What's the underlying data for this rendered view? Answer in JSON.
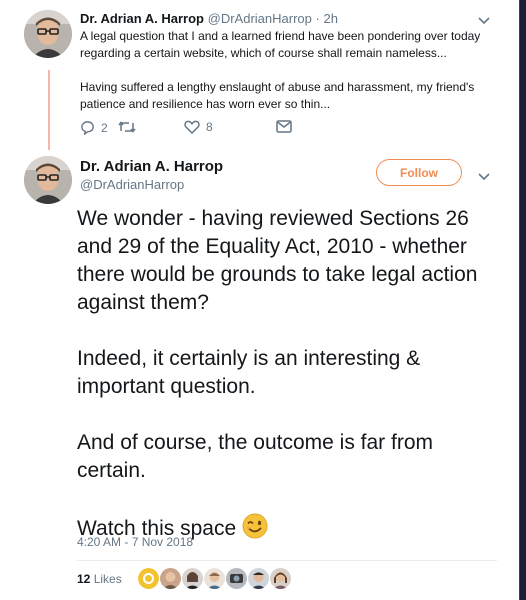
{
  "parent_tweet": {
    "author_name": "Dr. Adrian A. Harrop",
    "handle": "@DrAdrianHarrop",
    "separator": "·",
    "time": "2h",
    "paragraphs": [
      "A legal question that I and a learned friend have been pondering over today regarding a certain website, which of course shall remain nameless...",
      "Having suffered a lengthy enslaught of abuse and harassment, my friend's patience and resilience has worn ever so thin..."
    ],
    "reply_count": "2",
    "like_count": "8",
    "icons": [
      "reply-icon",
      "retweet-icon",
      "like-icon",
      "message-icon",
      "chevron-down-icon"
    ]
  },
  "main_tweet": {
    "author_name": "Dr. Adrian A. Harrop",
    "handle": "@DrAdrianHarrop",
    "follow_label": "Follow",
    "paragraphs": [
      "We wonder - having reviewed Sections 26 and 29 of the Equality Act, 2010 - whether there would be grounds to take legal action against them?",
      "Indeed, it certainly is an interesting & important question.",
      "And of course, the outcome is far from certain.",
      "Watch this space"
    ],
    "emoji": "winking-face-emoji",
    "timestamp": "4:20 AM - 7 Nov 2018",
    "likes_count": "12",
    "likes_label": "Likes"
  },
  "colors": {
    "accent": "#f08c54",
    "thread_line": "#f3b8a7",
    "secondary_text": "#657786",
    "frame": "#1b1f3b"
  }
}
